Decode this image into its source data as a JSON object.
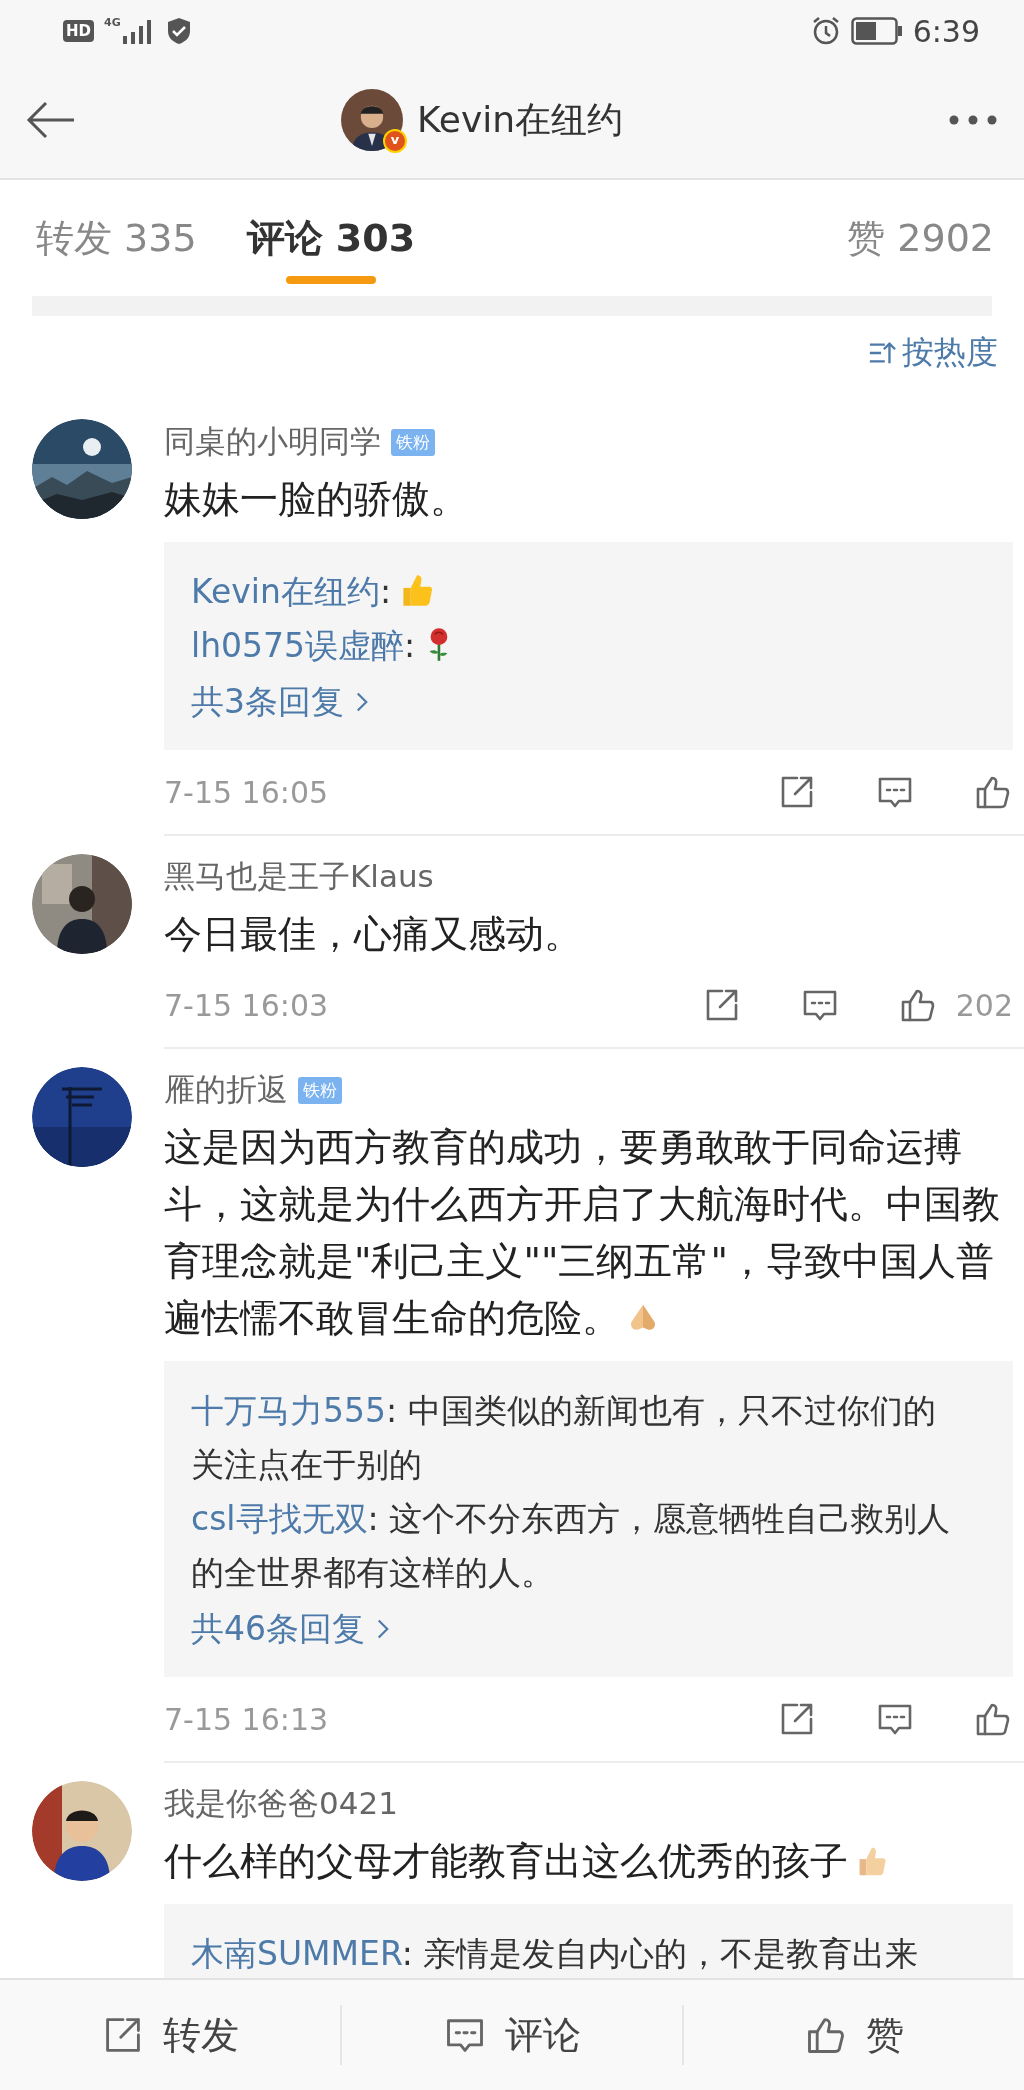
{
  "status_bar": {
    "hd": "HD",
    "network": "4G",
    "time": "6:39"
  },
  "header": {
    "title": "Kevin在纽约",
    "verified_mark": "v"
  },
  "tabs": [
    {
      "label": "转发 335",
      "selected": false
    },
    {
      "label": "评论 303",
      "selected": true
    },
    {
      "label": "赞 2902",
      "selected": false
    }
  ],
  "sort": {
    "label": "按热度"
  },
  "comments": [
    {
      "user": "同桌的小明同学",
      "badge": "铁粉",
      "avatar": {
        "kind": "picture"
      },
      "text": "妹妹一脸的骄傲。",
      "replies": [
        {
          "user": "Kevin在纽约",
          "text": ":",
          "emoji": {
            "kind": "thumbs-up"
          }
        },
        {
          "user": "lh0575误虚醉",
          "text": ":",
          "emoji": {
            "kind": "rose"
          }
        }
      ],
      "more": "共3条回复",
      "time": "7-15 16:05"
    },
    {
      "user": "黑马也是王子Klaus",
      "avatar": {
        "kind": "picture"
      },
      "text": "今日最佳，心痛又感动。",
      "time": "7-15 16:03",
      "likes": "202"
    },
    {
      "user": "雁的折返",
      "badge": "铁粉",
      "avatar": {
        "kind": "picture"
      },
      "text": "这是因为西方教育的成功，要勇敢敢于同命运搏斗，这就是为什么西方开启了大航海时代。中国教育理念就是\"利己主义\"\"三纲五常\"，导致中国人普遍怯懦不敢冒生命的危险。",
      "emoji": {
        "kind": "folded-hands"
      },
      "replies": [
        {
          "user": "十万马力555",
          "text": ": 中国类似的新闻也有，只不过你们的关注点在于别的"
        },
        {
          "user": "csl寻找无双",
          "text": ": 这个不分东西方，愿意牺牲自己救别人的全世界都有这样的人。"
        }
      ],
      "more": "共46条回复",
      "time": "7-15 16:13"
    },
    {
      "user": "我是你爸爸0421",
      "avatar": {
        "kind": "picture"
      },
      "text": "什么样的父母才能教育出这么优秀的孩子",
      "emoji": {
        "kind": "thumbs-up-light"
      },
      "replies": [
        {
          "user": "木南SUMMER",
          "text": ": 亲情是发自内心的，不是教育出来"
        }
      ]
    }
  ],
  "bottom_bar": [
    {
      "label": "转发",
      "kind": "share"
    },
    {
      "label": "评论",
      "kind": "comment"
    },
    {
      "label": "赞",
      "kind": "like"
    }
  ]
}
